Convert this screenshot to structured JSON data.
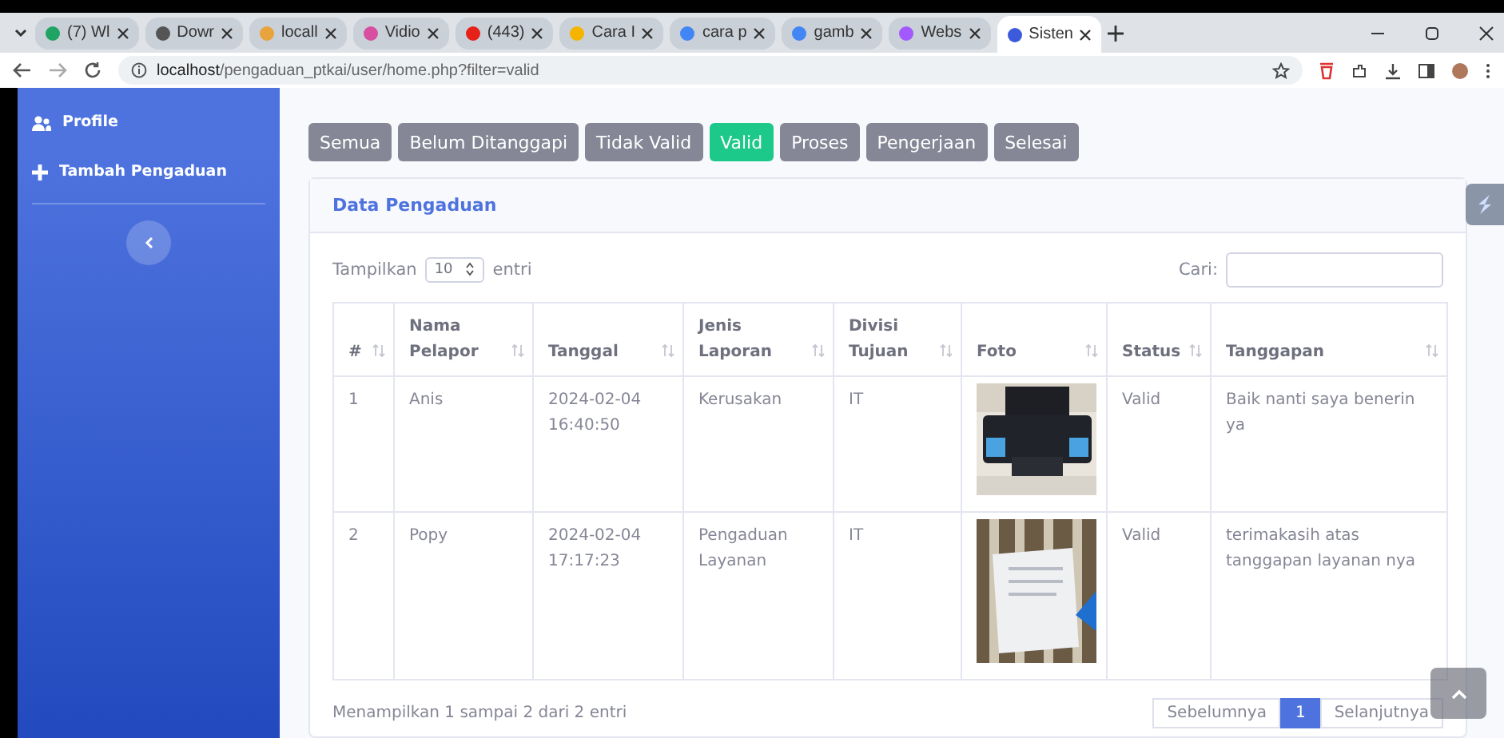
{
  "browser": {
    "tabs": [
      {
        "label": "(7) Wl",
        "selected": false
      },
      {
        "label": "Dowr",
        "selected": false
      },
      {
        "label": "locall",
        "selected": false
      },
      {
        "label": "Vidio",
        "selected": false
      },
      {
        "label": "(443)",
        "selected": false
      },
      {
        "label": "Cara I",
        "selected": false
      },
      {
        "label": "cara p",
        "selected": false
      },
      {
        "label": "gamb",
        "selected": false
      },
      {
        "label": "Webs",
        "selected": false
      },
      {
        "label": "Sisten",
        "selected": true
      }
    ],
    "url_host": "localhost",
    "url_path": "/pengaduan_ptkai/user/home.php?filter=valid"
  },
  "sidebar": {
    "items": [
      {
        "label": "Profile"
      },
      {
        "label": "Tambah Pengaduan"
      }
    ]
  },
  "filters": [
    {
      "label": "Semua",
      "selected": false
    },
    {
      "label": "Belum Ditanggapi",
      "selected": false
    },
    {
      "label": "Tidak Valid",
      "selected": false
    },
    {
      "label": "Valid",
      "selected": true
    },
    {
      "label": "Proses",
      "selected": false
    },
    {
      "label": "Pengerjaan",
      "selected": false
    },
    {
      "label": "Selesai",
      "selected": false
    }
  ],
  "card": {
    "title": "Data Pengaduan",
    "length_prefix": "Tampilkan",
    "length_value": "10",
    "length_suffix": "entri",
    "search_label": "Cari:",
    "table": {
      "columns": [
        "#",
        "Nama Pelapor",
        "Tanggal",
        "Jenis Laporan",
        "Divisi Tujuan",
        "Foto",
        "Status",
        "Tanggapan"
      ],
      "rows": [
        {
          "cells": [
            "1",
            "Anis",
            "2024-02-04 16:40:50",
            "Kerusakan",
            "IT"
          ],
          "status": "Valid",
          "response": "Baik nanti saya benerin ya"
        },
        {
          "cells": [
            "2",
            "Popy",
            "2024-02-04 17:17:23",
            "Pengaduan Layanan",
            "IT"
          ],
          "status": "Valid",
          "response": "terimakasih atas tanggapan layanan nya"
        }
      ]
    },
    "info": "Menampilkan 1 sampai 2 dari 2 entri",
    "pagination": [
      {
        "label": "Sebelumnya",
        "selected": false
      },
      {
        "label": "1",
        "selected": true
      },
      {
        "label": "Selanjutnya",
        "selected": false
      }
    ]
  }
}
